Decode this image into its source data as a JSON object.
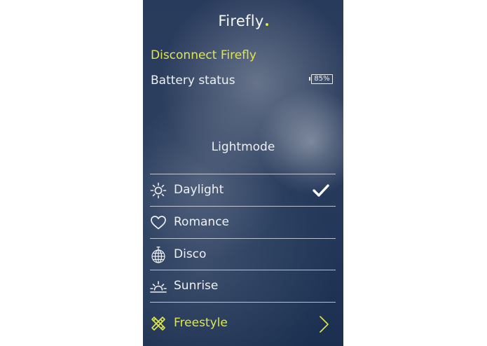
{
  "app": {
    "title": "Firefly"
  },
  "connection": {
    "disconnect_label": "Disconnect Firefly"
  },
  "battery": {
    "label": "Battery status",
    "value_text": "85%",
    "level": 0.85
  },
  "lightmode": {
    "title": "Lightmode",
    "modes": [
      {
        "label": "Daylight",
        "icon": "sun-icon",
        "selected": true
      },
      {
        "label": "Romance",
        "icon": "heart-icon",
        "selected": false
      },
      {
        "label": "Disco",
        "icon": "disco-ball-icon",
        "selected": false
      },
      {
        "label": "Sunrise",
        "icon": "sunrise-icon",
        "selected": false
      }
    ],
    "freestyle": {
      "label": "Freestyle",
      "icon": "crossed-tools-icon"
    }
  },
  "colors": {
    "accent": "#e1e64a",
    "background_top": "#293b5c",
    "background_bottom": "#1b2f50",
    "text": "#eef0f4"
  }
}
